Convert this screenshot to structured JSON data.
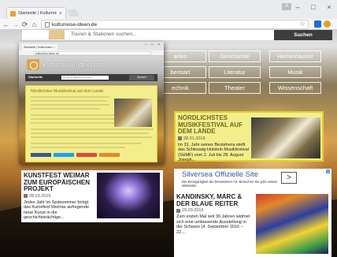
{
  "browser": {
    "tab_label": "Startseite | Kulturreise-I...",
    "tab_close": "×",
    "url": "kulturreise-ideen.de",
    "nav_back": "←",
    "nav_forward": "→",
    "nav_reload": "⟳",
    "nav_home": "⌂",
    "bookmark_star": "☆",
    "window_minimize": "–",
    "window_maximize": "□",
    "window_close": "×",
    "account_badge": "A"
  },
  "site": {
    "search_placeholder": "Touren & Stationen suchen...",
    "search_button": "Suchen",
    "categories": [
      "Gärten",
      "Geschichte",
      "Herrenhäuser",
      "Kunsthandwerk",
      "Literatur",
      "Musik",
      "Technik",
      "Theater",
      "Wissenschaft"
    ],
    "categories_visible": [
      "arten",
      "Geschichte",
      "Herrenhäuser",
      "bensart",
      "Literatur",
      "Musik",
      "echnik",
      "Theater",
      "Wissenschaft"
    ]
  },
  "articles": [
    {
      "title": "NÖRDLICHSTES MUSIKFESTIVAL AUF DEM LANDE",
      "date": "28.01.2016",
      "body": "Im 31. Jahr seines Bestehens stellt das Schleswig-Holstein Musikfestival (SHMF) vom 2. Juli bis 28. August Joseph..."
    },
    {
      "title": "KUNSTFEST WEIMAR ZUM EUROPÄISCHEN PROJEKT",
      "date": "28.03.2016",
      "body": "Jedes Jahr im Spätsommer bringt das Kunstfest Weimar aufregende neue Kunst in die geschichtsträchtige..."
    },
    {
      "title": "KANDINSKY, MARC & DER BLAUE REITER",
      "date": "29.03.2016",
      "body": "Zum ersten Mal seit 30 Jahren widmet sich eine umfassende Ausstellung in der Schweiz (4. September 2016 – 22...."
    }
  ],
  "ad": {
    "title": "Silversea Offizielle Site",
    "subtitle": "Die Einzigartigkeit der besonderen Art. Besuchen Sie jetzt unsere Webseite!",
    "button": ">"
  },
  "popup": {
    "site_name": "kulturreise-ideen.de",
    "nav_label": "Startseite",
    "search_placeholder": "Touren & Stationen suchen...",
    "search_button": "Suchen",
    "article_title": "Nördlichstes Musikfestival auf dem Lande"
  },
  "colors": {
    "highlight": "#f3ee8c",
    "highlight_border": "#e2cf2e",
    "dark_button": "#3d3d3d",
    "ad_link": "#2a5db0"
  }
}
